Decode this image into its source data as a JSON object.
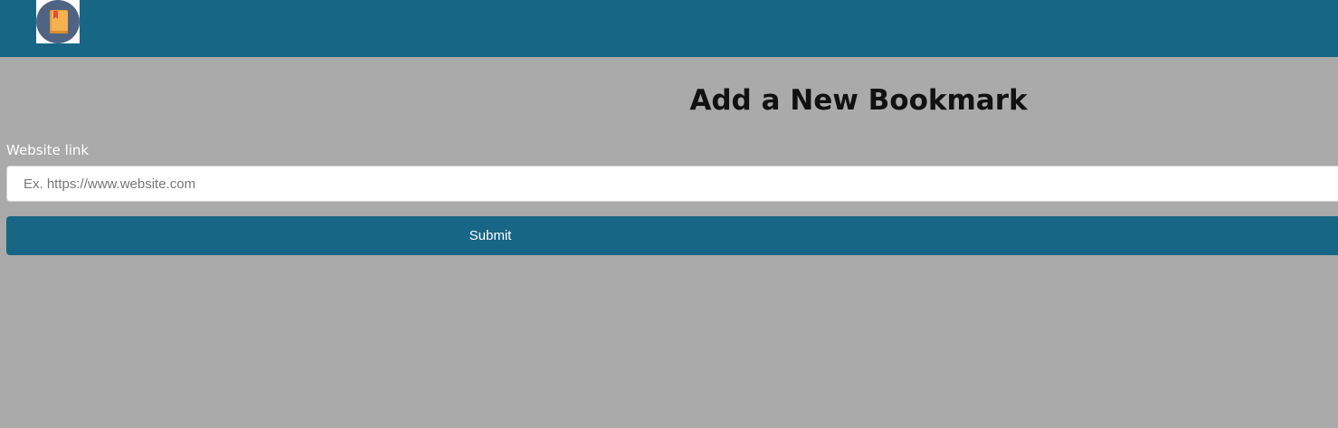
{
  "header": {
    "logo_icon": "bookmark-book-icon",
    "colors": {
      "bar": "#176685",
      "logo_circle": "#4f6483",
      "book": "#f4b350",
      "ribbon": "#e8473b"
    }
  },
  "main": {
    "title": "Add a New Bookmark",
    "form": {
      "label": "Website link",
      "placeholder": "Ex. https://www.website.com",
      "value": "",
      "submit_label": "Submit"
    },
    "colors": {
      "background": "#aaaaaa",
      "button": "#176685"
    }
  }
}
